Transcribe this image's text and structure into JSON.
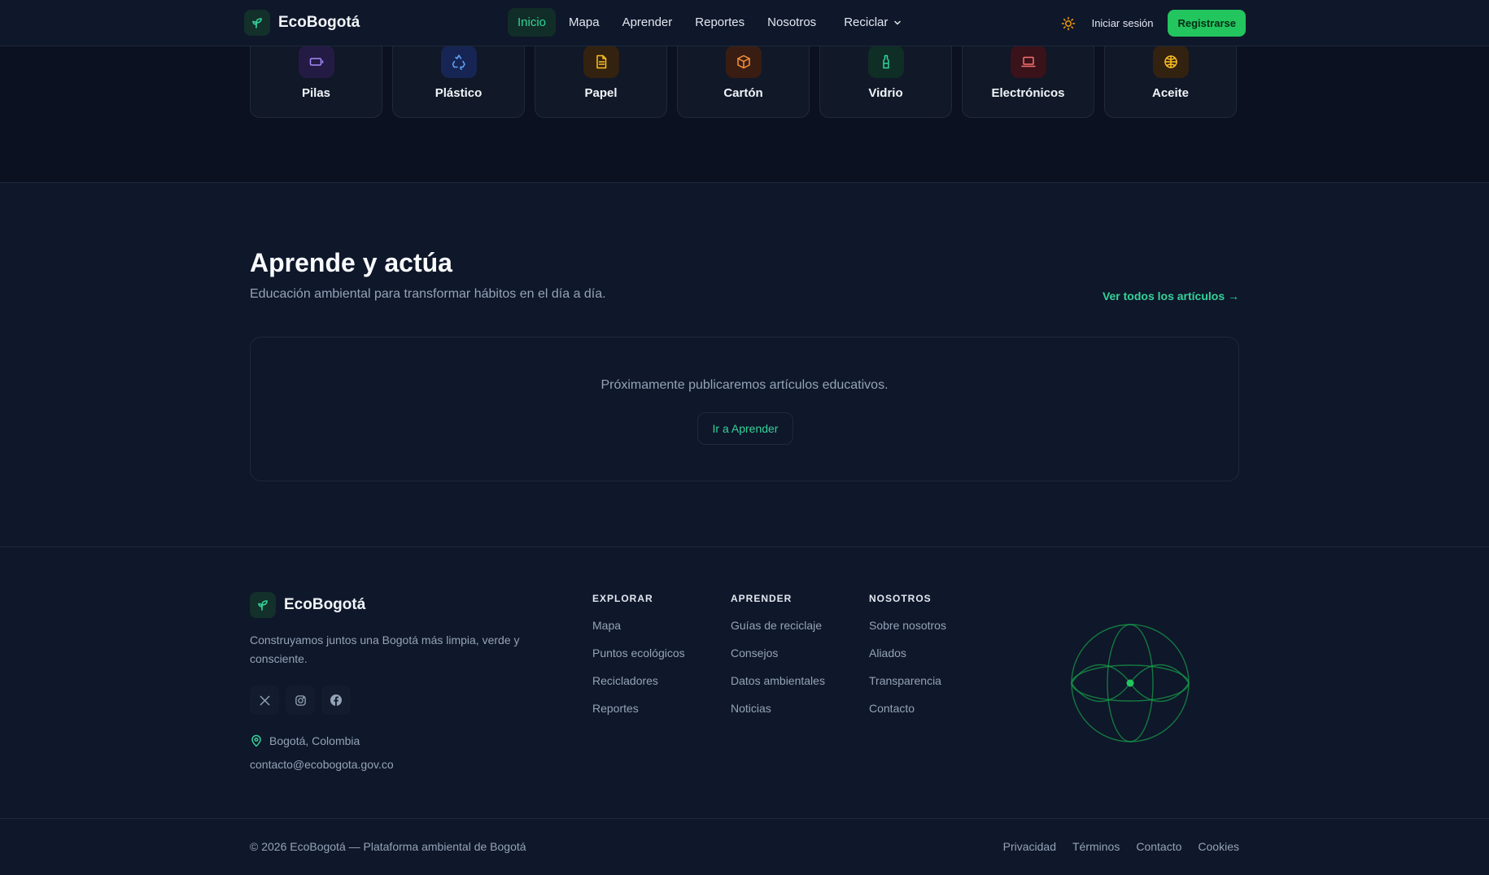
{
  "nav": {
    "brand": "EcoBogotá",
    "links": [
      "Inicio",
      "Mapa",
      "Aprender",
      "Reportes",
      "Nosotros"
    ],
    "dropdown": "Reciclar",
    "login": "Iniciar sesión",
    "register": "Registrarse"
  },
  "categories": [
    {
      "label": "Pilas",
      "icon": "battery-icon",
      "color": "#a78bfa",
      "bg": "#241b45"
    },
    {
      "label": "Plástico",
      "icon": "recycle-icon",
      "color": "#60a5fa",
      "bg": "#172554"
    },
    {
      "label": "Papel",
      "icon": "document-icon",
      "color": "#fbbf24",
      "bg": "#33220f"
    },
    {
      "label": "Cartón",
      "icon": "box-icon",
      "color": "#fb923c",
      "bg": "#3a1d12"
    },
    {
      "label": "Vidrio",
      "icon": "bottle-icon",
      "color": "#34d399",
      "bg": "#0f2e26"
    },
    {
      "label": "Electrónicos",
      "icon": "laptop-icon",
      "color": "#f87171",
      "bg": "#3a1219"
    },
    {
      "label": "Aceite",
      "icon": "oil-icon",
      "color": "#fbbf24",
      "bg": "#33220f"
    }
  ],
  "learn": {
    "title": "Aprende y actúa",
    "subtitle": "Educación ambiental para transformar hábitos en el día a día.",
    "link": "Ver todos los artículos →",
    "empty_text": "Próximamente publicaremos artículos educativos.",
    "empty_button": "Ir a Aprender"
  },
  "footer": {
    "brand": "EcoBogotá",
    "description": "Construyamos juntos una Bogotá más limpia, verde y consciente.",
    "location": "Bogotá, Colombia",
    "email": "contacto@ecobogota.gov.co",
    "columns": [
      {
        "title": "EXPLORAR",
        "items": [
          "Mapa",
          "Puntos ecológicos",
          "Recicladores",
          "Reportes"
        ]
      },
      {
        "title": "APRENDER",
        "items": [
          "Guías de reciclaje",
          "Consejos",
          "Datos ambientales",
          "Noticias"
        ]
      },
      {
        "title": "NOSOTROS",
        "items": [
          "Sobre nosotros",
          "Aliados",
          "Transparencia",
          "Contacto"
        ]
      }
    ],
    "copyright": "© 2026 EcoBogotá — Plataforma ambiental de Bogotá",
    "legal": [
      "Privacidad",
      "Términos",
      "Contacto",
      "Cookies"
    ]
  },
  "colors": {
    "accent": "#22c55e",
    "accent_text": "#34d399",
    "bg": "#0f172a"
  }
}
